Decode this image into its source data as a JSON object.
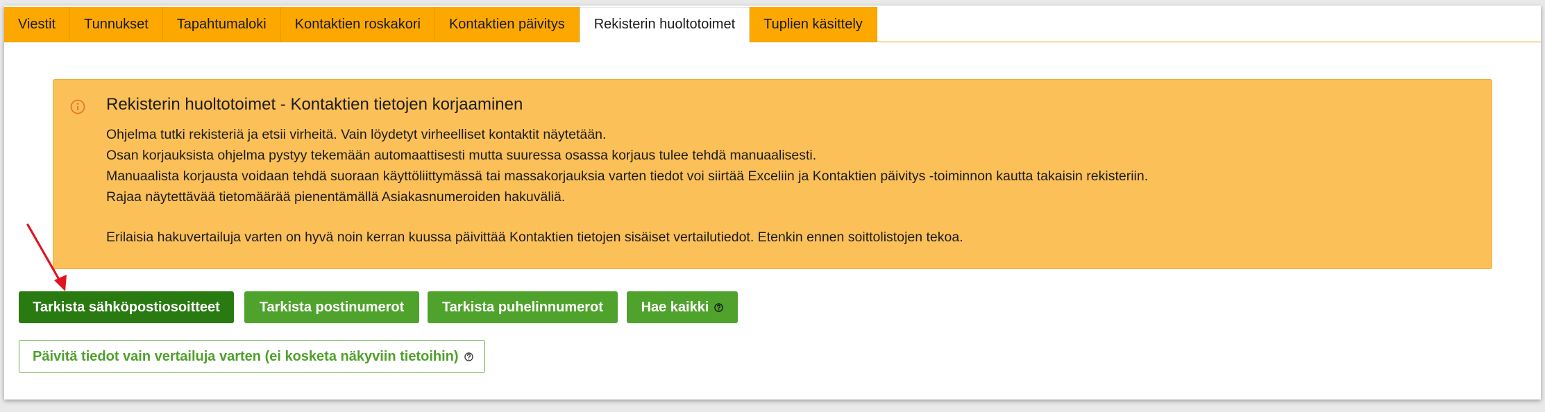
{
  "tabs": [
    {
      "label": "Viestit",
      "active": false
    },
    {
      "label": "Tunnukset",
      "active": false
    },
    {
      "label": "Tapahtumaloki",
      "active": false
    },
    {
      "label": "Kontaktien roskakori",
      "active": false
    },
    {
      "label": "Kontaktien päivitys",
      "active": false
    },
    {
      "label": "Rekisterin huoltotoimet",
      "active": true
    },
    {
      "label": "Tuplien käsittely",
      "active": false
    }
  ],
  "notice": {
    "icon": "info-circle-icon",
    "title": "Rekisterin huoltotoimet - Kontaktien tietojen korjaaminen",
    "lines": [
      "Ohjelma tutki rekisteriä ja etsii virheitä. Vain löydetyt virheelliset kontaktit näytetään.",
      "Osan korjauksista ohjelma pystyy tekemään automaattisesti mutta suuressa osassa korjaus tulee tehdä manuaalisesti.",
      "Manuaalista korjausta voidaan tehdä suoraan käyttöliittymässä tai massakorjauksia varten tiedot voi siirtää Exceliin ja Kontaktien päivitys -toiminnon kautta takaisin rekisteriin.",
      "Rajaa näytettävää tietomäärää pienentämällä Asiakasnumeroiden hakuväliä."
    ],
    "extra_line": "Erilaisia hakuvertailuja varten on hyvä noin kerran kuussa päivittää Kontaktien tietojen sisäiset vertailutiedot. Etenkin ennen soittolistojen tekoa."
  },
  "buttons": {
    "check_emails": "Tarkista sähköpostiosoitteet",
    "check_postcodes": "Tarkista postinumerot",
    "check_phones": "Tarkista puhelinnumerot",
    "fetch_all": "Hae kaikki",
    "update_compare": "Päivitä tiedot vain vertailuja varten (ei kosketa näkyviin tietoihin)"
  },
  "colors": {
    "tab_orange": "#fda800",
    "notice_bg": "#fcc058",
    "primary_green": "#2a7a12",
    "success_green": "#4fa32c",
    "annotation_red": "#e0141e"
  }
}
